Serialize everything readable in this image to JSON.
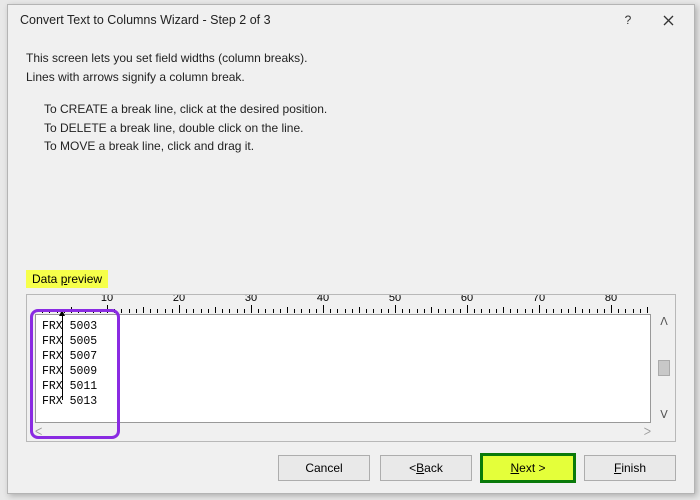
{
  "dialog": {
    "title": "Convert Text to Columns Wizard - Step 2 of 3"
  },
  "intro": {
    "line1": "This screen lets you set field widths (column breaks).",
    "line2": "Lines with arrows signify a column break."
  },
  "instructions": {
    "create": "To CREATE a break line, click at the desired position.",
    "delete": "To DELETE a break line, double click on the line.",
    "move": "To MOVE a break line, click and drag it."
  },
  "preview": {
    "label_prefix": "Data ",
    "label_underlined": "p",
    "label_suffix": "review",
    "ruler_ticks": [
      10,
      20,
      30,
      40,
      50,
      60,
      70,
      80
    ],
    "break_positions": [
      4
    ],
    "rows": [
      "FRX 5003",
      "FRX 5005",
      "FRX 5007",
      "FRX 5009",
      "FRX 5011",
      "FRX 5013"
    ]
  },
  "buttons": {
    "cancel": "Cancel",
    "back_prefix": "< ",
    "back_u": "B",
    "back_suffix": "ack",
    "next_u": "N",
    "next_suffix": "ext >",
    "finish_u": "F",
    "finish_suffix": "inish"
  },
  "annotations": {
    "purple_highlight": true,
    "next_highlight": true
  }
}
